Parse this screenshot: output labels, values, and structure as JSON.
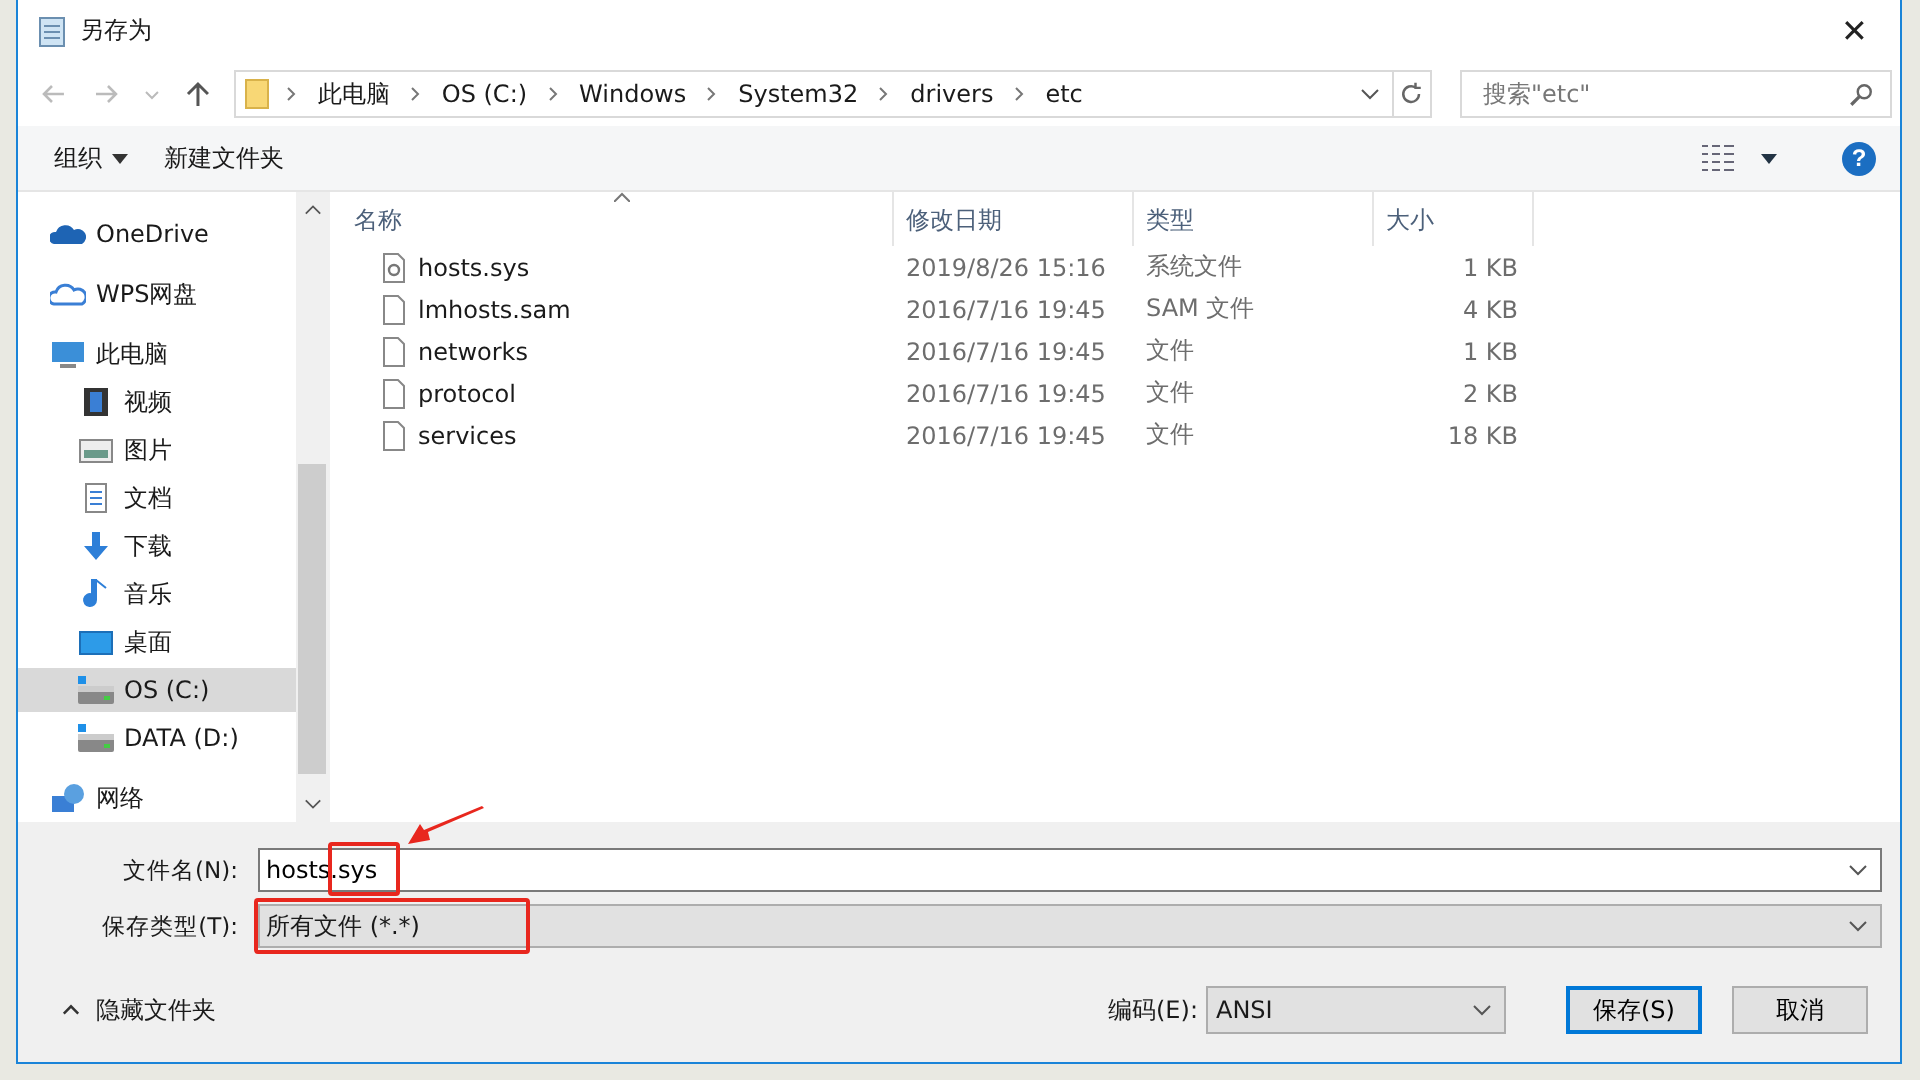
{
  "window": {
    "title": "另存为",
    "close": "✕"
  },
  "address": {
    "segments": [
      "此电脑",
      "OS (C:)",
      "Windows",
      "System32",
      "drivers",
      "etc"
    ]
  },
  "search": {
    "placeholder": "搜索\"etc\""
  },
  "toolbar": {
    "organize": "组织",
    "new_folder": "新建文件夹",
    "help": "?"
  },
  "nav": [
    {
      "label": "OneDrive",
      "kind": "cloud",
      "selected": false
    },
    {
      "label": "WPS网盘",
      "kind": "cloud-outline",
      "selected": false
    },
    {
      "label": "此电脑",
      "kind": "computer",
      "selected": false,
      "children": [
        {
          "label": "视频",
          "kind": "video",
          "selected": false
        },
        {
          "label": "图片",
          "kind": "image",
          "selected": false
        },
        {
          "label": "文档",
          "kind": "doc",
          "selected": false
        },
        {
          "label": "下载",
          "kind": "download",
          "selected": false
        },
        {
          "label": "音乐",
          "kind": "music",
          "selected": false
        },
        {
          "label": "桌面",
          "kind": "desktop",
          "selected": false
        },
        {
          "label": "OS (C:)",
          "kind": "drive",
          "selected": true
        },
        {
          "label": "DATA (D:)",
          "kind": "drive",
          "selected": false
        }
      ]
    },
    {
      "label": "网络",
      "kind": "network",
      "selected": false
    }
  ],
  "table": {
    "columns": [
      "名称",
      "修改日期",
      "类型",
      "大小"
    ],
    "rows": [
      {
        "kind": "system",
        "name": "hosts.sys",
        "date": "2019/8/26 15:16",
        "type": "系统文件",
        "size": "1 KB"
      },
      {
        "kind": "file",
        "name": "lmhosts.sam",
        "date": "2016/7/16 19:45",
        "type": "SAM 文件",
        "size": "4 KB"
      },
      {
        "kind": "file",
        "name": "networks",
        "date": "2016/7/16 19:45",
        "type": "文件",
        "size": "1 KB"
      },
      {
        "kind": "file",
        "name": "protocol",
        "date": "2016/7/16 19:45",
        "type": "文件",
        "size": "2 KB"
      },
      {
        "kind": "file",
        "name": "services",
        "date": "2016/7/16 19:45",
        "type": "文件",
        "size": "18 KB"
      }
    ]
  },
  "filename": {
    "label": "文件名(N):",
    "value": "hosts.sys"
  },
  "filetype": {
    "label": "保存类型(T):",
    "value": "所有文件 (*.*)"
  },
  "hide_folders": "隐藏文件夹",
  "encoding": {
    "label": "编码(E):",
    "value": "ANSI"
  },
  "buttons": [
    "保存(S)",
    "取消"
  ]
}
